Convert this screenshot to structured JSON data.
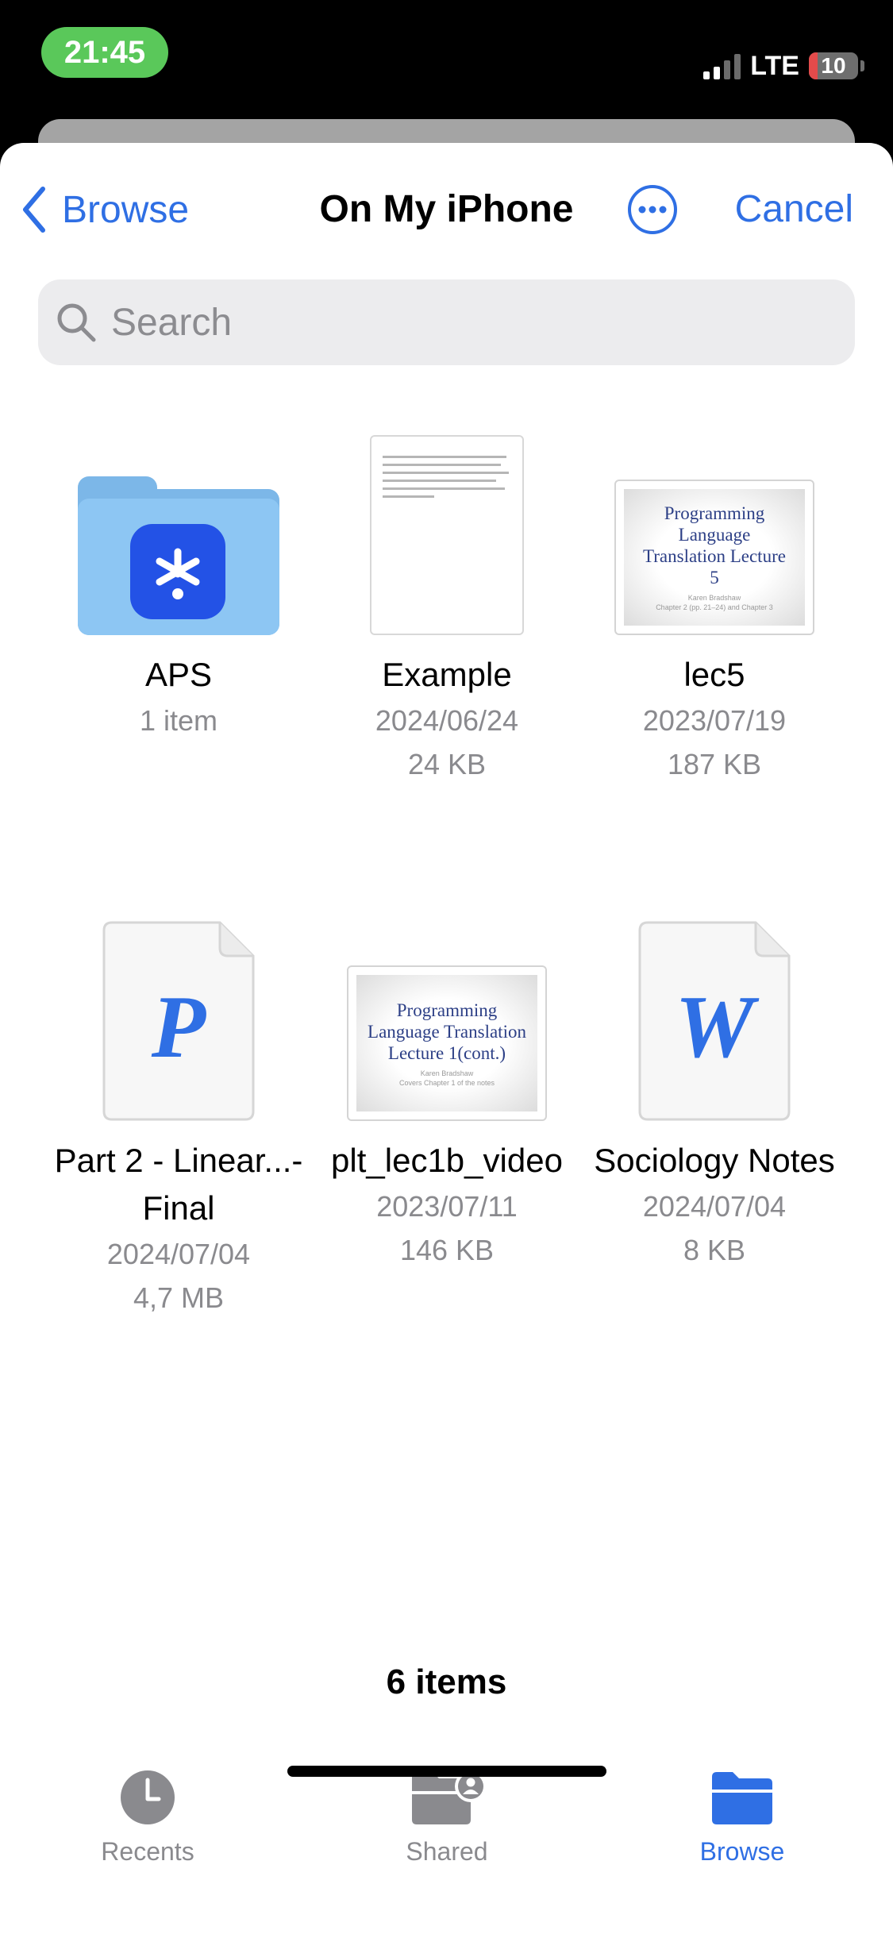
{
  "status_bar": {
    "time": "21:45",
    "network": "LTE",
    "battery": "10",
    "battery_percent": 10,
    "signal_bars_active": 2,
    "signal_bars_total": 4
  },
  "nav": {
    "back_label": "Browse",
    "title": "On My iPhone",
    "more_icon": "ellipsis-circle-icon",
    "cancel_label": "Cancel"
  },
  "search": {
    "placeholder": "Search",
    "value": ""
  },
  "items": [
    {
      "name": "APS",
      "line1": "1 item",
      "line2": "",
      "kind": "folder"
    },
    {
      "name": "Example",
      "line1": "2024/06/24",
      "line2": "24 KB",
      "kind": "text-document"
    },
    {
      "name": "lec5",
      "line1": "2023/07/19",
      "line2": "187 KB",
      "kind": "presentation",
      "thumb_title": "Programming Language Translation Lecture 5",
      "thumb_sub1": "Karen Bradshaw",
      "thumb_sub2": "Chapter 2 (pp. 21–24) and Chapter 3"
    },
    {
      "name": "Part 2 - Linear...- Final",
      "line1": "2024/07/04",
      "line2": "4,7 MB",
      "kind": "pages-document",
      "letter": "P"
    },
    {
      "name": "plt_lec1b_video",
      "line1": "2023/07/11",
      "line2": "146 KB",
      "kind": "presentation",
      "thumb_title": "Programming Language Translation Lecture 1(cont.)",
      "thumb_sub1": "Karen Bradshaw",
      "thumb_sub2": "Covers Chapter 1 of the notes"
    },
    {
      "name": "Sociology Notes",
      "line1": "2024/07/04",
      "line2": "8 KB",
      "kind": "word-document",
      "letter": "W"
    }
  ],
  "footer": {
    "item_count": "6 items"
  },
  "tabbar": {
    "tabs": [
      {
        "label": "Recents",
        "icon": "clock-icon",
        "active": false
      },
      {
        "label": "Shared",
        "icon": "shared-folder-icon",
        "active": false
      },
      {
        "label": "Browse",
        "icon": "folder-icon",
        "active": true
      }
    ]
  },
  "colors": {
    "accent": "#2f6fe4",
    "inactive": "#8a8a8e",
    "time_pill": "#5ac85a"
  }
}
